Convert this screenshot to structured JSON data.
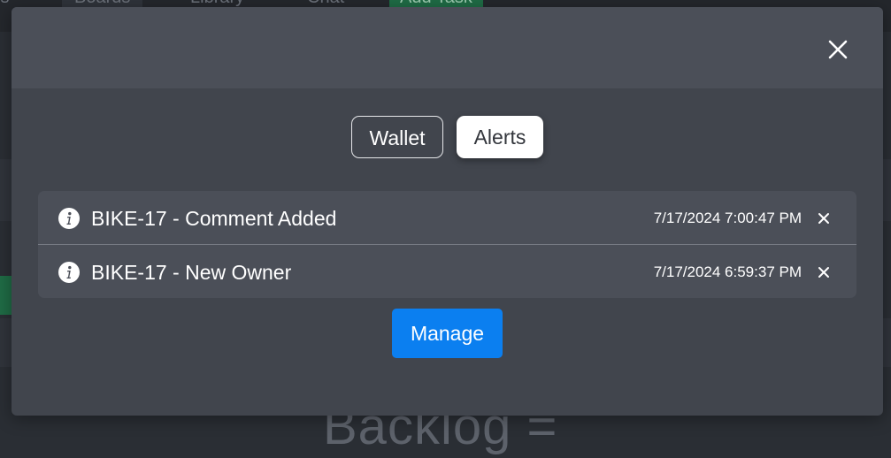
{
  "background": {
    "nav_tabs": [
      "Boards",
      "Library",
      "Chat",
      "Add Task"
    ],
    "big_text": "Backlog ="
  },
  "modal": {
    "close_icon": "close-icon",
    "segments": [
      {
        "label": "Wallet",
        "active": false
      },
      {
        "label": "Alerts",
        "active": true
      }
    ],
    "alerts": [
      {
        "icon": "info-icon",
        "title": "BIKE-17 - Comment Added",
        "time": "7/17/2024 7:00:47 PM"
      },
      {
        "icon": "info-icon",
        "title": "BIKE-17 - New Owner",
        "time": "7/17/2024 6:59:37 PM"
      }
    ],
    "manage_label": "Manage"
  },
  "colors": {
    "accent": "#0b7ff0",
    "modal_bg": "#41454d",
    "header_bg": "#4b4f58"
  }
}
